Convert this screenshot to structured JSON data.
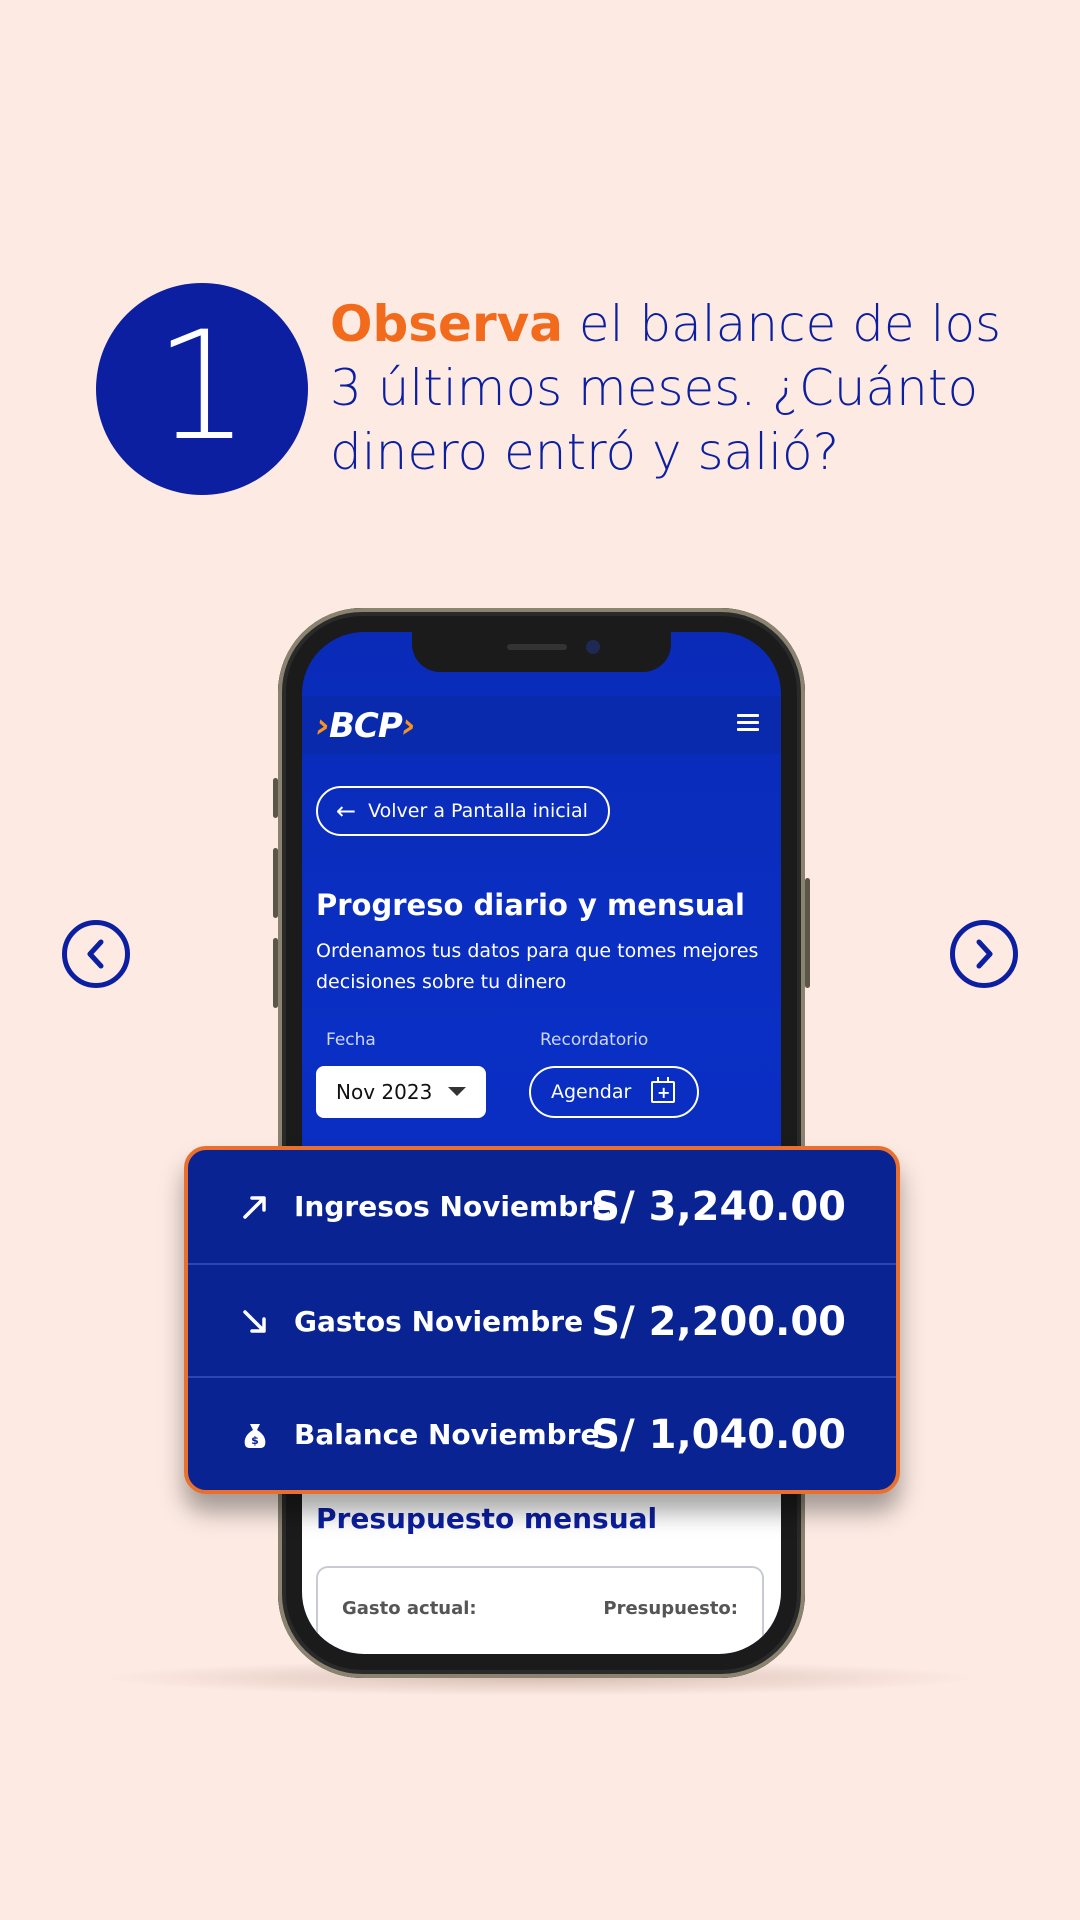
{
  "step": {
    "number": "1",
    "headline_accent": "Observa",
    "headline_rest": " el balance de los 3 últimos meses. ¿Cuánto dinero entró y salió?"
  },
  "app": {
    "logo": "BCP",
    "back_button": "Volver a Pantalla inicial",
    "section_title": "Progreso diario y mensual",
    "section_description": "Ordenamos tus datos para que tomes mejores decisiones sobre tu dinero",
    "date_label": "Fecha",
    "date_value": "Nov 2023",
    "reminder_label": "Recordatorio",
    "schedule_button": "Agendar",
    "budget_title": "Presupuesto mensual",
    "current_expense_label": "Gasto actual:",
    "budget_label": "Presupuesto:"
  },
  "summary": {
    "rows": [
      {
        "label": "Ingresos Noviembre",
        "value": "S/ 3,240.00",
        "icon": "trend-up-icon"
      },
      {
        "label": "Gastos Noviembre",
        "value": "S/ 2,200.00",
        "icon": "trend-down-icon"
      },
      {
        "label": "Balance Noviembre",
        "value": "S/ 1,040.00",
        "icon": "money-bag-icon"
      }
    ]
  },
  "colors": {
    "background": "#FDEAE3",
    "brand_blue": "#0B1FA0",
    "accent_orange": "#F26A1B"
  }
}
